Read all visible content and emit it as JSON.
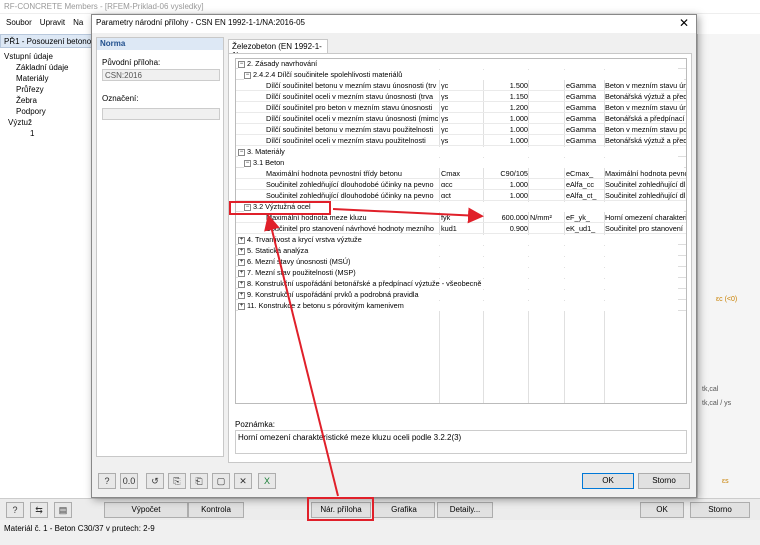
{
  "app": {
    "title": "RF-CONCRETE Members - [RFEM-Priklad-06 vysledky]",
    "menu": [
      "Soubor",
      "Upravit",
      "Na"
    ],
    "nav_header": "PŘ1 - Posouzení betonový",
    "nav_items": [
      "Vstupní údaje",
      "Základní údaje",
      "Materiály",
      "Průřezy",
      "Žebra",
      "Podpory",
      "Výztuž",
      "1"
    ],
    "right_labels": [
      "εc (<0)",
      "tk,cal",
      "tk,cal / ys",
      "εs"
    ],
    "bottom_buttons": {
      "calc": "Výpočet",
      "check": "Kontrola",
      "national_annex": "Nár. příloha",
      "graphics": "Grafika",
      "details": "Detaily...",
      "ok": "OK",
      "cancel": "Storno"
    },
    "status": "Materiál č. 1  -  Beton C30/37 v prutech: 2-9"
  },
  "dialog": {
    "title": "Parametry národní přílohy - CSN EN 1992-1-1/NA:2016-05",
    "left": {
      "header": "Norma",
      "original_annex_label": "Původní příloha:",
      "original_annex_value": "CSN:2016",
      "designation_label": "Označení:",
      "designation_value": ""
    },
    "tab": "Železobeton (EN 1992-1-1)",
    "rows": [
      {
        "lvl": 0,
        "pm": "−",
        "text": "2. Zásady navrhování"
      },
      {
        "lvl": 1,
        "pm": "−",
        "text": "2.4.2.4 Dílčí součinitele spolehlivosti materiálů"
      },
      {
        "lvl": 2,
        "text": "Dílčí součinitel betonu v mezním stavu únosnosti (trv",
        "sym": "γc",
        "val": "1.500",
        "unit": "",
        "code": "eGamma",
        "desc": "Beton v mezním stavu ún"
      },
      {
        "lvl": 2,
        "text": "Dílčí součinitel oceli v mezním stavu únosnosti (trva",
        "sym": "γs",
        "val": "1.150",
        "unit": "",
        "code": "eGamma",
        "desc": "Betonářská výztuž a před"
      },
      {
        "lvl": 2,
        "text": "Dílčí součinitel pro beton v mezním stavu únosnosti",
        "sym": "γc",
        "val": "1.200",
        "unit": "",
        "code": "eGamma",
        "desc": "Beton v mezním stavu ún"
      },
      {
        "lvl": 2,
        "text": "Dílčí součinitel oceli v mezním stavu únosnosti (mimc",
        "sym": "γs",
        "val": "1.000",
        "unit": "",
        "code": "eGamma",
        "desc": "Betonářská a předpínací"
      },
      {
        "lvl": 2,
        "text": "Dílčí součinitel betonu v mezním stavu použitelnosti",
        "sym": "γc",
        "val": "1.000",
        "unit": "",
        "code": "eGamma",
        "desc": "Beton v mezním stavu po"
      },
      {
        "lvl": 2,
        "text": "Dílčí součinitel oceli v mezním stavu použitelnosti",
        "sym": "γs",
        "val": "1.000",
        "unit": "",
        "code": "eGamma",
        "desc": "Betonářská výztuž a před"
      },
      {
        "lvl": 0,
        "pm": "−",
        "text": "3. Materiály"
      },
      {
        "lvl": 1,
        "pm": "−",
        "text": "3.1 Beton"
      },
      {
        "lvl": 2,
        "text": "Maximální hodnota pevnostní třídy betonu",
        "sym": "Cmax",
        "val": "C90/105",
        "unit": "",
        "code": "eCmax_",
        "desc": "Maximální hodnota pevno"
      },
      {
        "lvl": 2,
        "text": "Součinitel zohledňující dlouhodobé účinky na pevno",
        "sym": "αcc",
        "val": "1.000",
        "unit": "",
        "code": "eAlfa_cc",
        "desc": "Součinitel zohledňující dl"
      },
      {
        "lvl": 2,
        "text": "Součinitel zohledňující dlouhodobé účinky na pevno",
        "sym": "αct",
        "val": "1.000",
        "unit": "",
        "code": "eAlfa_ct_",
        "desc": "Součinitel zohledňující dl"
      },
      {
        "lvl": 1,
        "pm": "−",
        "text": "3.2 Výztužná ocel"
      },
      {
        "lvl": 2,
        "text": "Maximální hodnota meze kluzu",
        "sym": "fyk",
        "val": "600.000",
        "unit": "N/mm²",
        "code": "eF_yk_",
        "desc": "Horní omezení charakteri"
      },
      {
        "lvl": 2,
        "text": "Součinitel pro stanovení návrhové hodnoty mezního",
        "sym": "kud1",
        "val": "0.900",
        "unit": "",
        "code": "eK_ud1_",
        "desc": "Součinitel pro stanovení"
      },
      {
        "lvl": 0,
        "pm": "+",
        "text": "4. Trvanlivost a krycí vrstva výztuže"
      },
      {
        "lvl": 0,
        "pm": "+",
        "text": "5. Statická analýza"
      },
      {
        "lvl": 0,
        "pm": "+",
        "text": "6. Mezní stavy únosnosti (MSÚ)"
      },
      {
        "lvl": 0,
        "pm": "+",
        "text": "7. Mezní stav použitelnosti (MSP)"
      },
      {
        "lvl": 0,
        "pm": "+",
        "text": "8. Konstrukční uspořádání betonářské a předpínací výztuže - všeobecně"
      },
      {
        "lvl": 0,
        "pm": "+",
        "text": "9. Konstrukční uspořádání prvků a podrobná pravidla"
      },
      {
        "lvl": 0,
        "pm": "+",
        "text": "11. Konstrukce z betonu s pórovitým kamenivem"
      }
    ],
    "note_label": "Poznámka:",
    "note_text": "Horní omezení charakteristické meze kluzu oceli podle 3.2.2(3)",
    "ok": "OK",
    "cancel": "Storno"
  },
  "colors": {
    "highlight": "#e0202a",
    "header_bg": "#dde8f5",
    "accent": "#1f4e8c"
  }
}
